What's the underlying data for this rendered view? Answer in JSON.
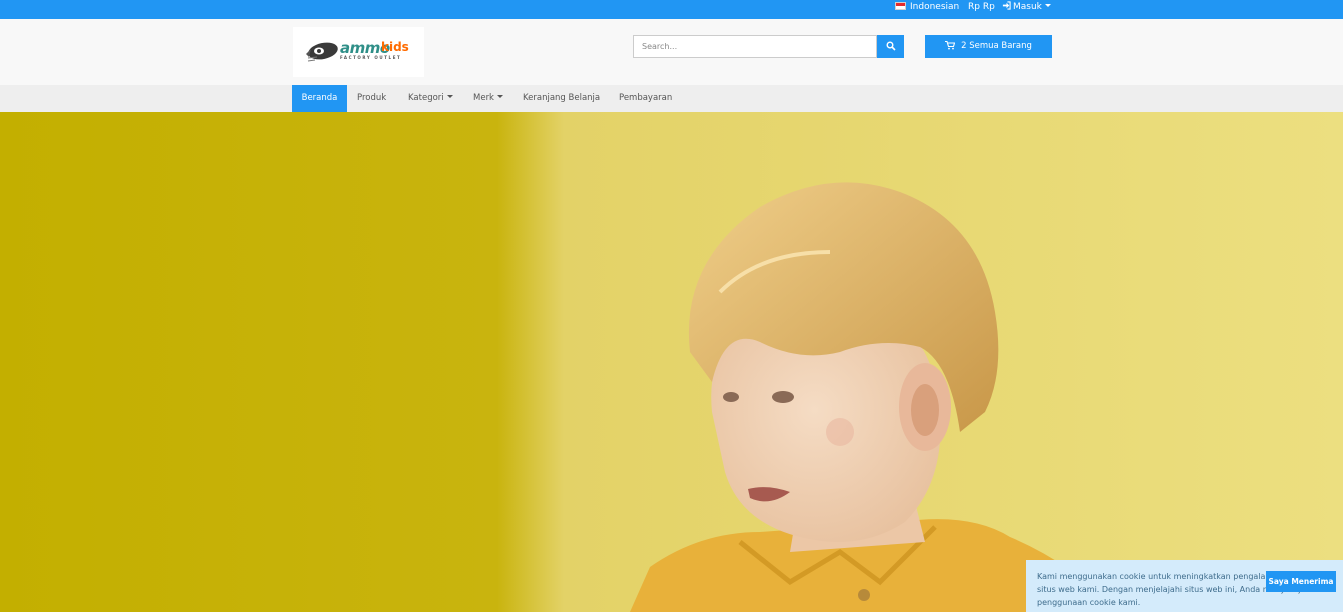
{
  "topbar": {
    "language": "Indonesian",
    "currency": "Rp Rp",
    "login": "Masuk",
    "background_color": "#2196f3"
  },
  "header": {
    "logo_text_ammo": "ammo",
    "logo_text_kids": "kids",
    "logo_tagline": "FACTORY OUTLET",
    "search_placeholder": "Search...",
    "search_icon": "search-icon",
    "cart_icon": "cart-icon",
    "cart_label": "2 Semua Barang"
  },
  "nav": {
    "items": [
      {
        "label": "Beranda",
        "active": true
      },
      {
        "label": "Produk"
      },
      {
        "label": "Kategori",
        "dropdown": true
      },
      {
        "label": "Merk",
        "dropdown": true
      },
      {
        "label": "Keranjang Belanja"
      },
      {
        "label": "Pembayaran"
      }
    ]
  },
  "hero": {
    "colors": {
      "left_wall": "#c4b000",
      "right_wall": "#ebdb77",
      "shirt": "#e8b13a",
      "hair": "#e0b468"
    }
  },
  "cookie": {
    "text": "Kami menggunakan cookie untuk meningkatkan pengalaman Anda di situs web kami. Dengan menjelajahi situs web ini, Anda menyetujui penggunaan cookie kami.",
    "accept_label": "Saya Menerima"
  }
}
